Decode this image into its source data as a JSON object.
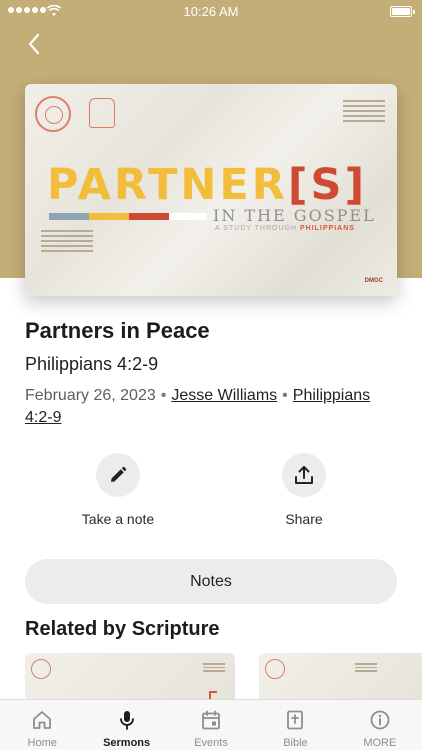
{
  "status_bar": {
    "time": "10:26 AM"
  },
  "artwork": {
    "title_main": "PARTNER",
    "title_bracket": "[S]",
    "subtitle": "IN THE GOSPEL",
    "subtitle_small": "A STUDY THROUGH",
    "subtitle_book": "PHILIPPIANS",
    "logo_text": "DMGC",
    "bar_colors": [
      "#8fa4b3",
      "#f2bd3b",
      "#f2bd3b",
      "#cf4a33",
      "#ffffff"
    ]
  },
  "sermon": {
    "title": "Partners in Peace",
    "scripture": "Philippians 4:2-9",
    "date": "February 26, 2023",
    "separator": "•",
    "speaker": "Jesse Williams",
    "scripture_link": "Philippians 4:2-9"
  },
  "actions": {
    "take_note": "Take a note",
    "share": "Share"
  },
  "notes_button": "Notes",
  "related": {
    "heading": "Related by Scripture"
  },
  "tabbar": {
    "items": [
      {
        "label": "Home",
        "icon": "home-icon"
      },
      {
        "label": "Sermons",
        "icon": "microphone-icon"
      },
      {
        "label": "Events",
        "icon": "calendar-icon"
      },
      {
        "label": "Bible",
        "icon": "bible-icon"
      },
      {
        "label": "MORE",
        "icon": "info-icon"
      }
    ],
    "active": "Sermons"
  },
  "colors": {
    "header_background": "#c4ae78",
    "title_yellow": "#f2bd3b",
    "title_red": "#cf4a33",
    "button_gray": "#ececec"
  }
}
